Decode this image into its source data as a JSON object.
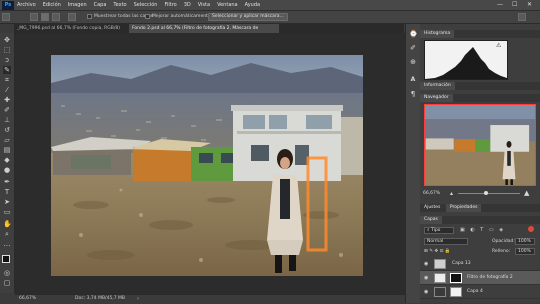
{
  "menubar": {
    "logo": "Ps",
    "items": [
      "Archivo",
      "Edición",
      "Imagen",
      "Capa",
      "Texto",
      "Selección",
      "Filtro",
      "3D",
      "Vista",
      "Ventana",
      "Ayuda"
    ],
    "minimize": "—",
    "maximize": "☐",
    "close": "✕"
  },
  "options": {
    "sample_all_layers": "Muestrear todas las capas",
    "auto_enhance": "Mejorar automáticamente",
    "select_mask_button": "Seleccionar y aplicar máscara..."
  },
  "tabs": [
    {
      "label": "_MG_7996.psd al 66,7% (Fondo copia, RGB/8)"
    },
    {
      "label": "Fondo 2.psd al 66,7% (Filtro de fotografía 2, Máscara de capa/16)"
    }
  ],
  "status": {
    "zoom": "66,67%",
    "doc": "Doc: 3,74 MB/45,7 MB"
  },
  "histogram": {
    "title": "Histograma"
  },
  "info_panel": {
    "title": "Información"
  },
  "navigator": {
    "title": "Navegador",
    "zoom": "66,67%"
  },
  "adjust_panel": {
    "tabs": [
      "Ajustes",
      "Propiedades"
    ]
  },
  "layers_panel": {
    "title": "Capas",
    "filter_kind": "Tipo",
    "blend_mode": "Normal",
    "opacity_label": "Opacidad:",
    "opacity_value": "100%",
    "fill_label": "Relleno:",
    "fill_value": "100%",
    "layers": [
      {
        "name": "Capa 13"
      },
      {
        "name": "Filtro de fotografía 2"
      },
      {
        "name": "Capa 4"
      }
    ]
  },
  "colors": {
    "accent": "#31a8ff",
    "selection": "#ff8a2a"
  }
}
